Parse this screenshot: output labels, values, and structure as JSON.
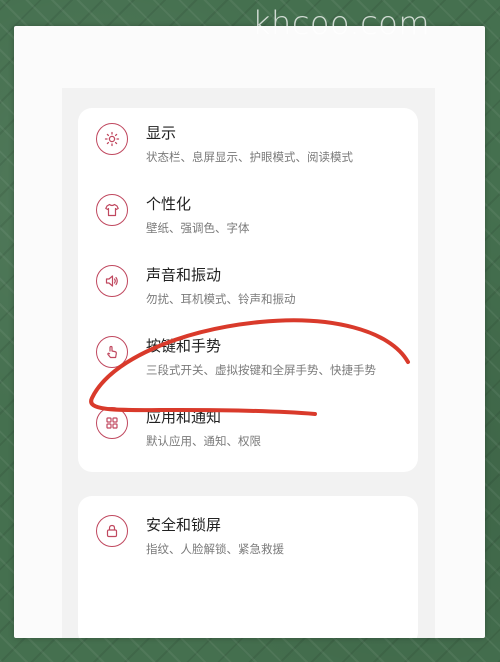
{
  "watermark": "khcoo.com",
  "settings": {
    "group1": [
      {
        "title": "显示",
        "subtitle": "状态栏、息屏显示、护眼模式、阅读模式",
        "icon": "brightness-icon"
      },
      {
        "title": "个性化",
        "subtitle": "壁纸、强调色、字体",
        "icon": "tshirt-icon"
      },
      {
        "title": "声音和振动",
        "subtitle": "勿扰、耳机模式、铃声和振动",
        "icon": "speaker-icon"
      },
      {
        "title": "按键和手势",
        "subtitle": "三段式开关、虚拟按键和全屏手势、快捷手势",
        "icon": "gesture-icon"
      },
      {
        "title": "应用和通知",
        "subtitle": "默认应用、通知、权限",
        "icon": "apps-grid-icon"
      }
    ],
    "group2": [
      {
        "title": "安全和锁屏",
        "subtitle": "指纹、人脸解锁、紧急救援",
        "icon": "lock-icon"
      }
    ]
  },
  "colors": {
    "accent": "#c0485f",
    "annotation": "#d93a2b",
    "background": "#45704f"
  }
}
